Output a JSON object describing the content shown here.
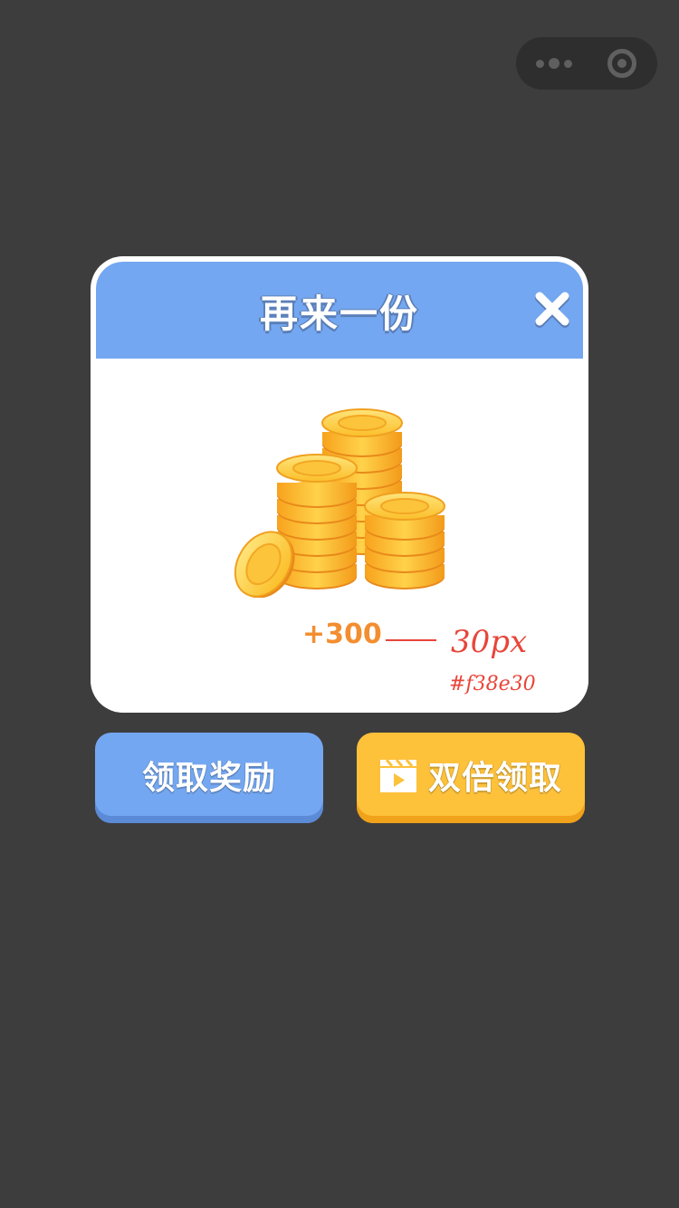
{
  "capsule": {
    "more_icon": "more-dots-icon",
    "close_icon": "miniprogram-close-icon"
  },
  "dialog": {
    "title": "再来一份",
    "close_icon": "close-x-icon",
    "reward_amount": "+300",
    "illustration": "gold-coins-stack",
    "annotation": {
      "size_note": "30px",
      "color_note": "#f38e30"
    }
  },
  "buttons": {
    "claim_label": "领取奖励",
    "double_label": "双倍领取",
    "double_icon": "video-clapperboard-icon"
  },
  "colors": {
    "background": "#3d3d3d",
    "header_blue": "#74a7f1",
    "button_blue": "#74a7f1",
    "button_yellow": "#fdc13a",
    "reward_orange": "#f38e30"
  }
}
